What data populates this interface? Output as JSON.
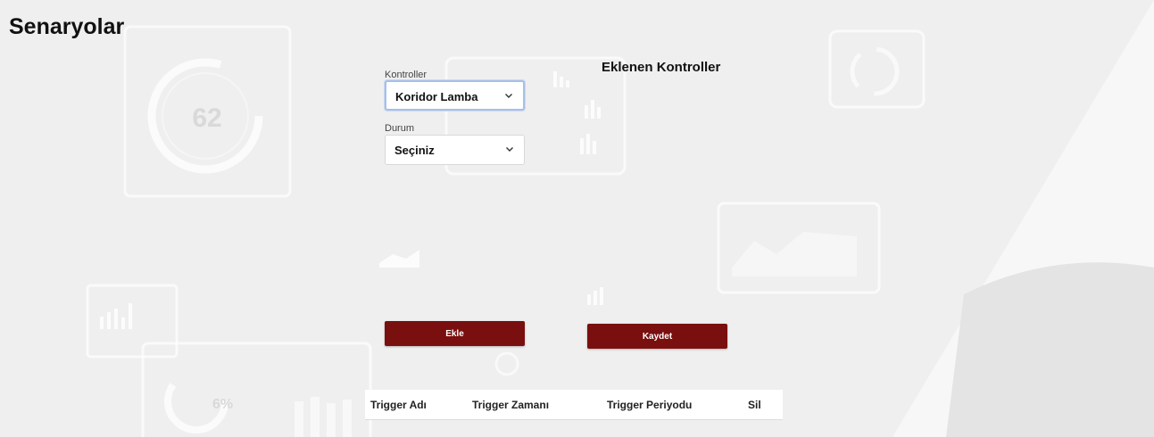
{
  "page": {
    "title": "Senaryolar"
  },
  "form": {
    "controls_label": "Kontroller",
    "controls_value": "Koridor Lamba",
    "status_label": "Durum",
    "status_value": "Seçiniz"
  },
  "added_controls": {
    "title": "Eklenen Kontroller"
  },
  "actions": {
    "add_label": "Ekle",
    "save_label": "Kaydet"
  },
  "table": {
    "columns": [
      "Trigger Adı",
      "Trigger Zamanı",
      "Trigger Periyodu",
      "Sil"
    ]
  },
  "background": {
    "gauge_values": [
      "62",
      "6%"
    ]
  },
  "colors": {
    "accent": "#7a0f0f",
    "focus": "#a8c0e6"
  }
}
